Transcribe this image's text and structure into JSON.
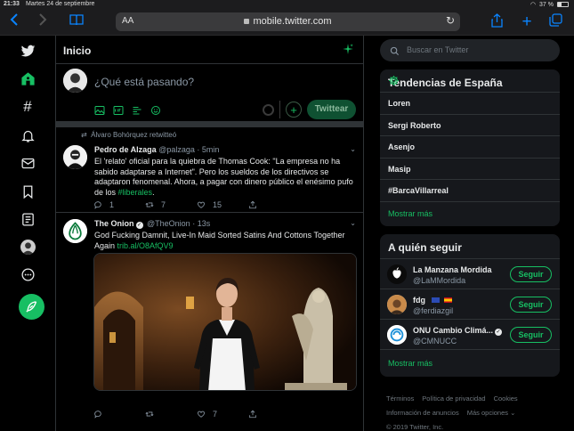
{
  "status_bar": {
    "time": "21:33",
    "date": "Martes 24 de septiembre",
    "battery": "37 %",
    "battery_level": 0.37
  },
  "browser": {
    "text_size_label": "AA",
    "url": "mobile.twitter.com"
  },
  "timeline": {
    "title": "Inicio",
    "compose": {
      "placeholder": "¿Qué está pasando?",
      "tweet_button": "Twittear"
    },
    "tweets": [
      {
        "retweeted_by": "Álvaro Bohórquez retwitteó",
        "name": "Pedro de Alzaga",
        "handle": "@palzaga",
        "time": "· 5min",
        "text": "El 'relato' oficial para la quiebra de Thomas Cook: \"La empresa no ha sabido adaptarse a Internet\". Pero los sueldos de los directivos se adaptaron fenomenal. Ahora, a pagar con dinero público el enésimo pufo de los ",
        "hashtag": "#liberales",
        "text_end": ".",
        "replies": "1",
        "retweets": "7",
        "likes": "15"
      },
      {
        "name": "The Onion",
        "handle": "@TheOnion",
        "time": "· 13s",
        "text": "God Fucking Damnit, Live-In Maid Sorted Satins And Cottons Together Again ",
        "link": "trib.al/O8AfQV9",
        "replies": "",
        "retweets": "",
        "likes": "7"
      }
    ]
  },
  "search": {
    "placeholder": "Buscar en Twitter"
  },
  "trends": {
    "title": "Tendencias de España",
    "items": [
      "Loren",
      "Sergi Roberto",
      "Asenjo",
      "Masip",
      "#BarcaVillarreal"
    ],
    "more": "Mostrar más"
  },
  "who_to_follow": {
    "title": "A quién seguir",
    "items": [
      {
        "name": "La Manzana Mordida",
        "handle": "@LaMMordida",
        "button": "Seguir"
      },
      {
        "name": "fdg",
        "handle": "@ferdiazgil",
        "button": "Seguir"
      },
      {
        "name": "ONU Cambio Climá...",
        "handle": "@CMNUCC",
        "button": "Seguir"
      }
    ],
    "more": "Mostrar más"
  },
  "footer": {
    "links": [
      "Términos",
      "Política de privacidad",
      "Cookies",
      "Información de anuncios",
      "Más opciones ⌄"
    ],
    "copyright": "© 2019 Twitter, Inc."
  },
  "colors": {
    "accent": "#17bf63",
    "background": "#000000",
    "card": "#16181c",
    "border": "#2f3336",
    "muted": "#8b98a5"
  }
}
